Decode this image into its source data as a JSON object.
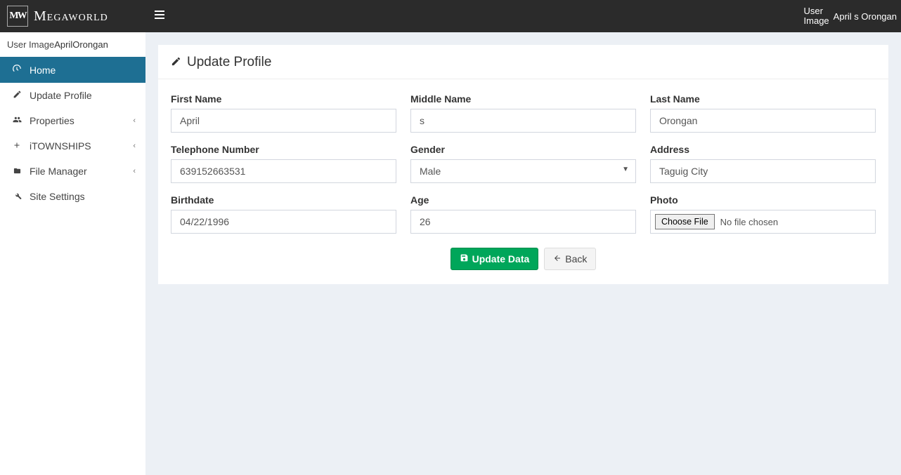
{
  "brand": {
    "logo_letters": "MW",
    "name": "Megaworld"
  },
  "header": {
    "user_image_label": "User\nImage",
    "user_name": "April s Orongan"
  },
  "sidebar": {
    "user_image_label": "User Image",
    "user_name": "AprilOrongan",
    "items": [
      {
        "label": "Home",
        "icon": "dashboard-icon",
        "active": true,
        "expandable": false
      },
      {
        "label": "Update Profile",
        "icon": "pencil-icon",
        "active": false,
        "expandable": false
      },
      {
        "label": "Properties",
        "icon": "users-icon",
        "active": false,
        "expandable": true
      },
      {
        "label": "iTOWNSHIPS",
        "icon": "plus-icon",
        "active": false,
        "expandable": true
      },
      {
        "label": "File Manager",
        "icon": "folder-icon",
        "active": false,
        "expandable": true
      },
      {
        "label": "Site Settings",
        "icon": "wrench-icon",
        "active": false,
        "expandable": false
      }
    ]
  },
  "page": {
    "title": "Update Profile",
    "fields": {
      "first_name": {
        "label": "First Name",
        "value": "April"
      },
      "middle_name": {
        "label": "Middle Name",
        "value": "s"
      },
      "last_name": {
        "label": "Last Name",
        "value": "Orongan"
      },
      "telephone": {
        "label": "Telephone Number",
        "value": "639152663531"
      },
      "gender": {
        "label": "Gender",
        "value": "Male"
      },
      "address": {
        "label": "Address",
        "value": "Taguig City"
      },
      "birthdate": {
        "label": "Birthdate",
        "value": "04/22/1996"
      },
      "age": {
        "label": "Age",
        "value": "26"
      },
      "photo": {
        "label": "Photo",
        "button": "Choose File",
        "placeholder": "No file chosen"
      }
    },
    "actions": {
      "update": "Update Data",
      "back": "Back"
    }
  }
}
